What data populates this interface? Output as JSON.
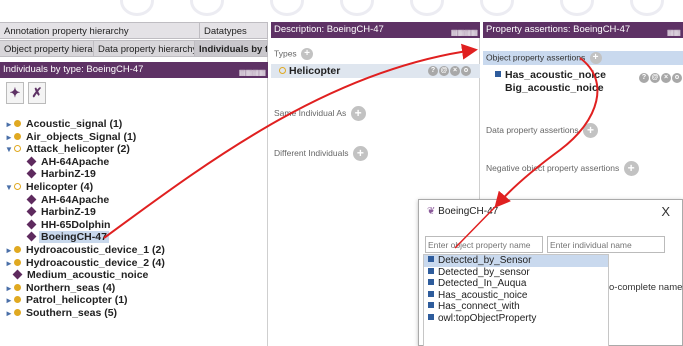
{
  "left": {
    "tabs_row1": [
      "Annotation property hierarchy",
      "Datatypes"
    ],
    "tabs_row2": [
      "Object property hierarchy",
      "Data property hierarchy",
      "Individuals by type"
    ],
    "view_header": "Individuals by type: BoeingCH-47",
    "tree": [
      {
        "label": "Acoustic_signal (1)",
        "kind": "class",
        "toggle": "►",
        "indent": 0
      },
      {
        "label": "Air_objects_Signal (1)",
        "kind": "class",
        "toggle": "►",
        "indent": 0
      },
      {
        "label": "Attack_helicopter (2)",
        "kind": "class-open",
        "toggle": "▼",
        "indent": 0
      },
      {
        "label": "AH-64Apache",
        "kind": "individual",
        "toggle": "",
        "indent": 1
      },
      {
        "label": "HarbinZ-19",
        "kind": "individual",
        "toggle": "",
        "indent": 1
      },
      {
        "label": "Helicopter (4)",
        "kind": "class-open",
        "toggle": "▼",
        "indent": 0
      },
      {
        "label": "AH-64Apache",
        "kind": "individual",
        "toggle": "",
        "indent": 1
      },
      {
        "label": "HarbinZ-19",
        "kind": "individual",
        "toggle": "",
        "indent": 1
      },
      {
        "label": "HH-65Dolphin",
        "kind": "individual",
        "toggle": "",
        "indent": 1
      },
      {
        "label": "BoeingCH-47",
        "kind": "individual",
        "toggle": "",
        "indent": 1,
        "selected": true
      },
      {
        "label": "Hydroacoustic_device_1 (2)",
        "kind": "class",
        "toggle": "►",
        "indent": 0
      },
      {
        "label": "Hydroacoustic_device_2 (4)",
        "kind": "class",
        "toggle": "►",
        "indent": 0
      },
      {
        "label": "Medium_acoustic_noice",
        "kind": "individual",
        "toggle": "",
        "indent": 0
      },
      {
        "label": "Northern_seas (4)",
        "kind": "class",
        "toggle": "►",
        "indent": 0
      },
      {
        "label": "Patrol_helicopter (1)",
        "kind": "class",
        "toggle": "►",
        "indent": 0
      },
      {
        "label": "Southern_seas (5)",
        "kind": "class",
        "toggle": "►",
        "indent": 0
      }
    ]
  },
  "middle": {
    "view_header": "Description: BoeingCH-47",
    "types_label": "Types",
    "type_value": "Helicopter",
    "same_individual_label": "Same Individual As",
    "different_individuals_label": "Different Individuals"
  },
  "right": {
    "view_header": "Property assertions: BoeingCH-47",
    "object_assertions_label": "Object property assertions",
    "assertion_property": "Has_acoustic_noice",
    "assertion_value": "Big_acoustic_noice",
    "data_assertions_label": "Data property assertions",
    "negative_assertions_label": "Negative object property assertions"
  },
  "dialog": {
    "title": "BoeingCH-47",
    "close": "X",
    "property_placeholder": "Enter object property name",
    "individual_placeholder": "Enter individual name",
    "background_hint": "o-complete names)",
    "options": [
      "Detected_by_Sensor",
      "Detected_by_sensor",
      "Detected_In_Auqua",
      "Has_acoustic_noice",
      "Has_connect_with",
      "owl:topObjectProperty"
    ],
    "highlighted_index": 0
  },
  "colors": {
    "header_purple": "#5e3265",
    "class_bullet": "#e0a921",
    "individual_diamond": "#5e2a5e",
    "arrow_red": "#e02020",
    "selection_blue": "#c8d8ec"
  }
}
